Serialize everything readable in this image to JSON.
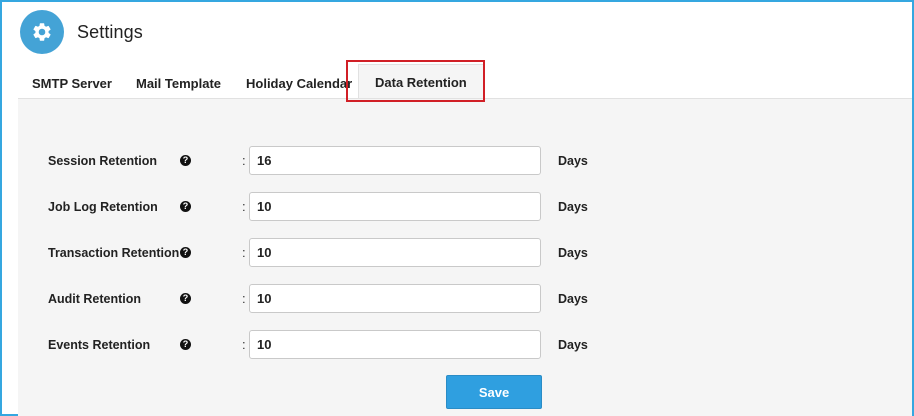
{
  "header": {
    "title": "Settings",
    "icon": "gear-icon"
  },
  "tabs": [
    {
      "label": "SMTP Server"
    },
    {
      "label": "Mail Template"
    },
    {
      "label": "Holiday Calendar"
    },
    {
      "label": "Data Retention",
      "active": true
    }
  ],
  "form": {
    "separator": ":",
    "rows": [
      {
        "label": "Session Retention",
        "value": "16",
        "unit": "Days"
      },
      {
        "label": "Job Log Retention",
        "value": "10",
        "unit": "Days"
      },
      {
        "label": "Transaction Retention",
        "value": "10",
        "unit": "Days"
      },
      {
        "label": "Audit Retention",
        "value": "10",
        "unit": "Days"
      },
      {
        "label": "Events Retention",
        "value": "10",
        "unit": "Days"
      }
    ],
    "save_label": "Save"
  },
  "colors": {
    "accent": "#44a3d6",
    "frame_border": "#35a7e0",
    "highlight": "#d11f26",
    "panel_bg": "#f5f5f5",
    "save_button": "#2f9fe0"
  }
}
